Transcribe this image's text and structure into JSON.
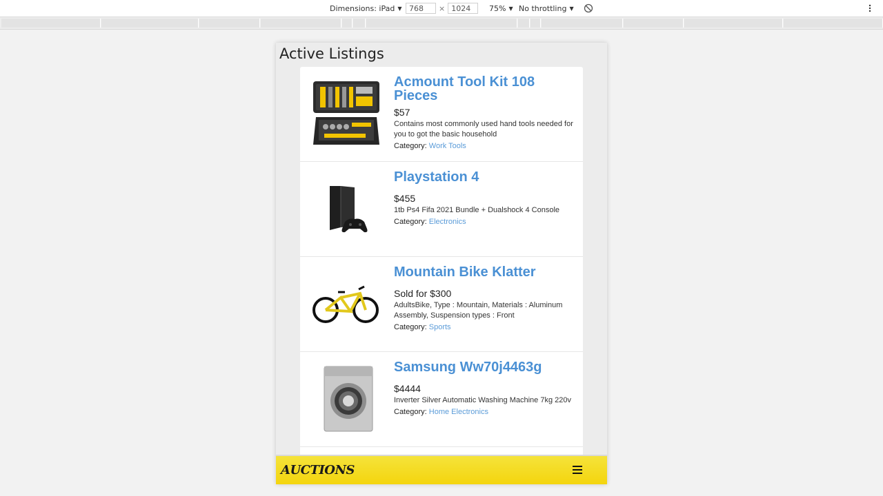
{
  "devtools": {
    "dimensions_label": "Dimensions: iPad",
    "width": "768",
    "times": "×",
    "height": "1024",
    "zoom": "75%",
    "throttling": "No throttling"
  },
  "page": {
    "title": "Active Listings",
    "category_label": "Category:",
    "logo": "AUCTIONS"
  },
  "listings": [
    {
      "title": "Acmount Tool Kit 108 Pieces",
      "price": "$57",
      "description": "Contains most commonly used hand tools needed for you to got the basic household",
      "category": "Work Tools",
      "image_icon": "toolkit-image"
    },
    {
      "title": "Playstation 4",
      "price": "$455",
      "description": "1tb Ps4 Fifa 2021 Bundle + Dualshock 4 Console",
      "category": "Electronics",
      "image_icon": "console-image"
    },
    {
      "title": "Mountain Bike Klatter",
      "price": "Sold for $300",
      "description": "AdultsBike, Type : Mountain, Materials : Aluminum Assembly, Suspension types : Front",
      "category": "Sports",
      "image_icon": "bicycle-image"
    },
    {
      "title": "Samsung Ww70j4463g",
      "price": "$4444",
      "description": "Inverter Silver Automatic Washing Machine 7kg 220v",
      "category": "Home Electronics",
      "image_icon": "washing-machine-image"
    }
  ],
  "colors": {
    "link": "#4a90d4",
    "footer": "#f4d40c"
  }
}
